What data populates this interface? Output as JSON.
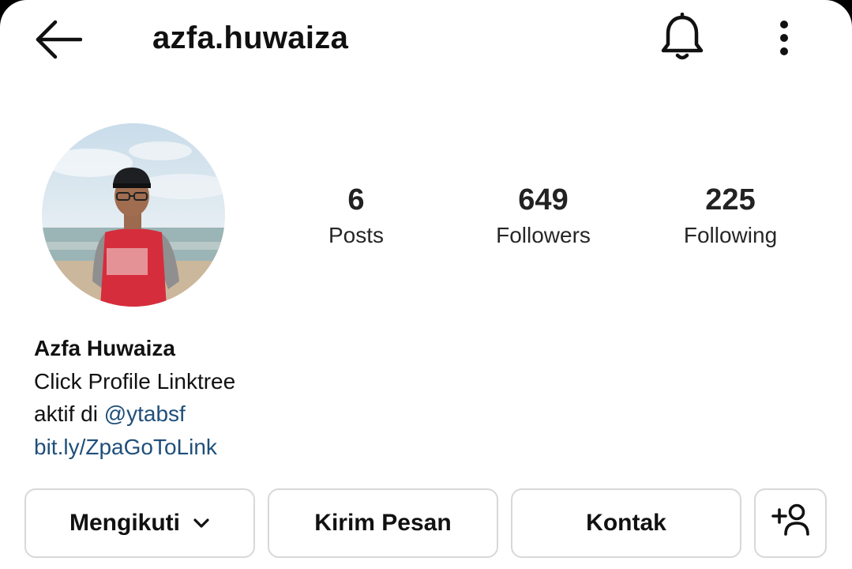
{
  "header": {
    "username": "azfa.huwaiza",
    "back_icon": "arrow-left-icon",
    "bell_icon": "bell-icon",
    "more_icon": "more-vertical-icon"
  },
  "stats": {
    "posts": {
      "value": "6",
      "label": "Posts"
    },
    "followers": {
      "value": "649",
      "label": "Followers"
    },
    "following": {
      "value": "225",
      "label": "Following"
    }
  },
  "bio": {
    "name": "Azfa Huwaiza",
    "line1": "Click Profile Linktree",
    "line2_prefix": "aktif di ",
    "mention": "@ytabsf",
    "link": "bit.ly/ZpaGoToLink"
  },
  "actions": {
    "following_label": "Mengikuti",
    "message_label": "Kirim Pesan",
    "contact_label": "Kontak",
    "add_user_icon": "add-person-icon"
  },
  "colors": {
    "link": "#1f4f7a",
    "text": "#111111",
    "border": "#d8d8d8"
  }
}
